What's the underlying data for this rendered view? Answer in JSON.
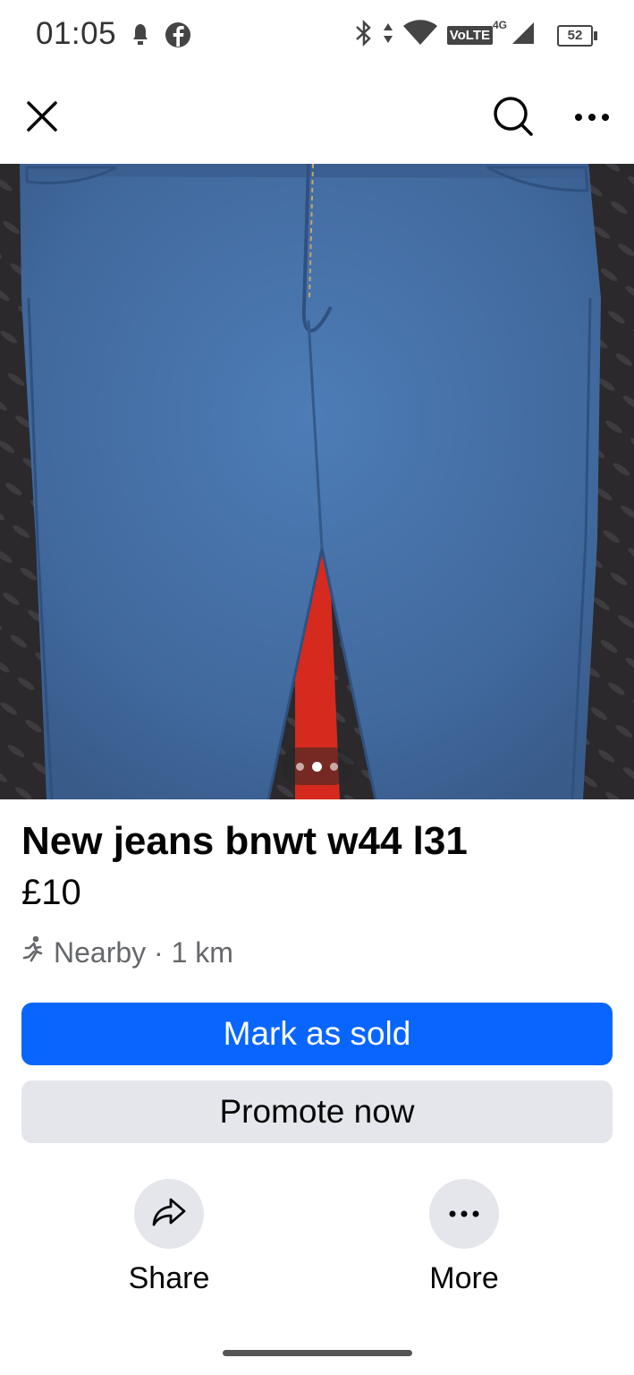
{
  "status_bar": {
    "time": "01:05",
    "battery": "52",
    "volte": "VoLTE",
    "network": "4G"
  },
  "nav": {
    "close_icon": "close-icon",
    "search_icon": "search-icon",
    "more_icon": "more-horizontal-icon"
  },
  "listing": {
    "title": "New jeans bnwt w44 l31",
    "price": "£10",
    "location": "Nearby · 1 km",
    "photo_count": 3,
    "active_photo": 2
  },
  "buttons": {
    "mark_sold": "Mark as sold",
    "promote": "Promote now"
  },
  "actions": {
    "share": "Share",
    "more": "More"
  },
  "colors": {
    "primary": "#0866ff",
    "secondary_bg": "#e4e6eb",
    "muted_text": "#65676b"
  }
}
